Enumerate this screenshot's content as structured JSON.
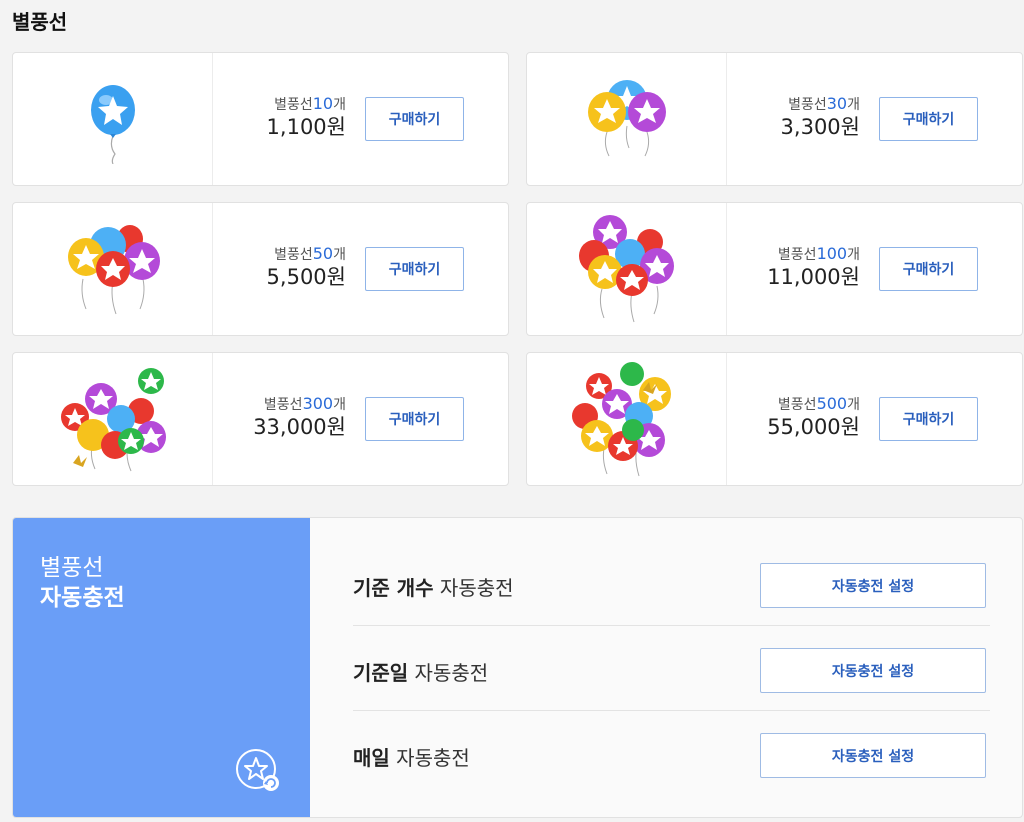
{
  "page": {
    "title": "별풍선"
  },
  "products": [
    {
      "qty_prefix": "별풍선",
      "qty": "10",
      "qty_suffix": "개",
      "price": "1,100원",
      "buy_label": "구매하기"
    },
    {
      "qty_prefix": "별풍선",
      "qty": "30",
      "qty_suffix": "개",
      "price": "3,300원",
      "buy_label": "구매하기"
    },
    {
      "qty_prefix": "별풍선",
      "qty": "50",
      "qty_suffix": "개",
      "price": "5,500원",
      "buy_label": "구매하기"
    },
    {
      "qty_prefix": "별풍선",
      "qty": "100",
      "qty_suffix": "개",
      "price": "11,000원",
      "buy_label": "구매하기"
    },
    {
      "qty_prefix": "별풍선",
      "qty": "300",
      "qty_suffix": "개",
      "price": "33,000원",
      "buy_label": "구매하기"
    },
    {
      "qty_prefix": "별풍선",
      "qty": "500",
      "qty_suffix": "개",
      "price": "55,000원",
      "buy_label": "구매하기"
    }
  ],
  "auto_charge": {
    "title_line1": "별풍선",
    "title_line2": "자동충전",
    "icon": "star-refresh-icon",
    "rows": [
      {
        "label_bold": "기준 개수",
        "label_rest": " 자동충전",
        "button": "자동충전 설정"
      },
      {
        "label_bold": "기준일",
        "label_rest": " 자동충전",
        "button": "자동충전 설정"
      },
      {
        "label_bold": "매일",
        "label_rest": " 자동충전",
        "button": "자동충전 설정"
      }
    ]
  },
  "colors": {
    "accent_blue": "#2a6bd8",
    "panel_blue": "#6a9ef7",
    "button_border": "#8fb4e8",
    "balloon_blue": "#3aa0f0",
    "balloon_yellow": "#f6c21c",
    "balloon_purple": "#b44ad8",
    "balloon_red": "#e8382e",
    "balloon_green": "#2db84a"
  }
}
